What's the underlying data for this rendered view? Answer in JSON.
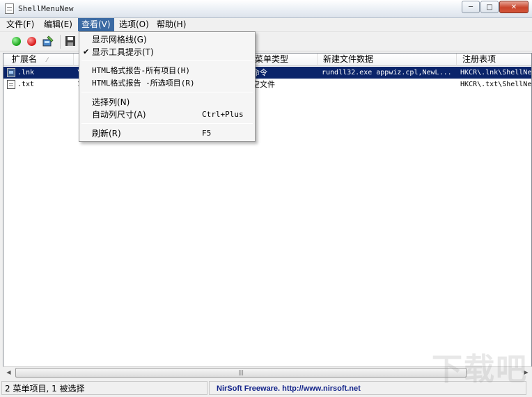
{
  "window": {
    "title": "ShellMenuNew",
    "min_glyph": "─",
    "max_glyph": "□",
    "close_glyph": "✕"
  },
  "menubar": {
    "file": "文件(F)",
    "edit": "编辑(E)",
    "view": "查看(V)",
    "options": "选项(O)",
    "help": "帮助(H)"
  },
  "view_menu": {
    "items": [
      {
        "label": "显示网格线(G)",
        "checked": false,
        "shortcut": ""
      },
      {
        "label": "显示工具提示(T)",
        "checked": true,
        "shortcut": ""
      },
      {
        "label": "HTML格式报告-所有项目(H)",
        "checked": false,
        "shortcut": ""
      },
      {
        "label": "HTML格式报告 -所选项目(R)",
        "checked": false,
        "shortcut": ""
      },
      {
        "label": "选择列(N)",
        "checked": false,
        "shortcut": ""
      },
      {
        "label": "自动列尺寸(A)",
        "checked": false,
        "shortcut": "Ctrl+Plus"
      },
      {
        "label": "刷新(R)",
        "checked": false,
        "shortcut": "F5"
      }
    ],
    "check_glyph": "✔"
  },
  "table": {
    "columns": [
      "扩展名",
      "菜单类型",
      "新建文件数据",
      "注册表项"
    ],
    "sort_glyph": "⁄",
    "rows": [
      {
        "ext": ".lnk",
        "col2": "\\",
        "type": "命令",
        "data": "rundll32.exe appwiz.cpl,NewL...",
        "key": "HKCR\\.lnk\\ShellNe",
        "selected": true
      },
      {
        "ext": ".txt",
        "col2": "1",
        "type": "空文件",
        "data": "",
        "key": "HKCR\\.txt\\ShellNe",
        "selected": false
      }
    ]
  },
  "scrollbar": {
    "left": "◀",
    "right": "▶",
    "grip": "|||"
  },
  "status": {
    "left": "2 菜单项目, 1 被选择",
    "right": "NirSoft Freeware.  http://www.nirsoft.net"
  },
  "watermark": "下载吧"
}
